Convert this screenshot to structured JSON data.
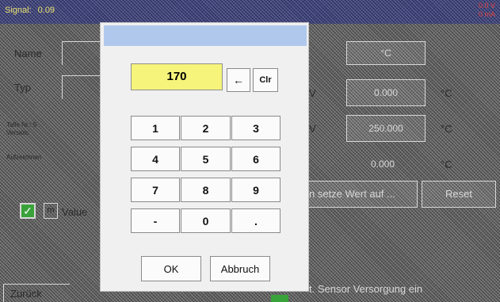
{
  "status": {
    "signal_label": "Signal:",
    "signal_value": "0.09",
    "right_line1": "0.0 V",
    "right_line2": "0 mA"
  },
  "background": {
    "name_label": "Name",
    "typ_label": "Typ",
    "tafel_line1": "Tafle Nr.: 5",
    "tafel_line2": "Version:",
    "aufzeichnen_label": "Aufzeichnen",
    "value_label": "Value",
    "zuruck_label": "Zurück",
    "unit_box": "°C",
    "row1_value": "0.000",
    "row1_unit": "°C",
    "row2_prefix": "V",
    "row2_value": "250.000",
    "row2_unit": "°C",
    "row3_value": "0.000",
    "row3_unit": "°C",
    "row_v1": "V",
    "setze_label": "n setze Wert auf ...",
    "reset_label": "Reset",
    "sensor_label": "t. Sensor Versorgung ein"
  },
  "dialog": {
    "display_value": "170",
    "backspace_icon": "left-arrow",
    "backspace_glyph": "←",
    "clear_label": "Clr",
    "keys": [
      "1",
      "2",
      "3",
      "4",
      "5",
      "6",
      "7",
      "8",
      "9",
      "-",
      "0",
      "."
    ],
    "ok_label": "OK",
    "cancel_label": "Abbruch"
  },
  "colors": {
    "display_bg": "#f6f47a",
    "title_bar": "#b0c8ec",
    "checkbox": "#3aa23a"
  }
}
